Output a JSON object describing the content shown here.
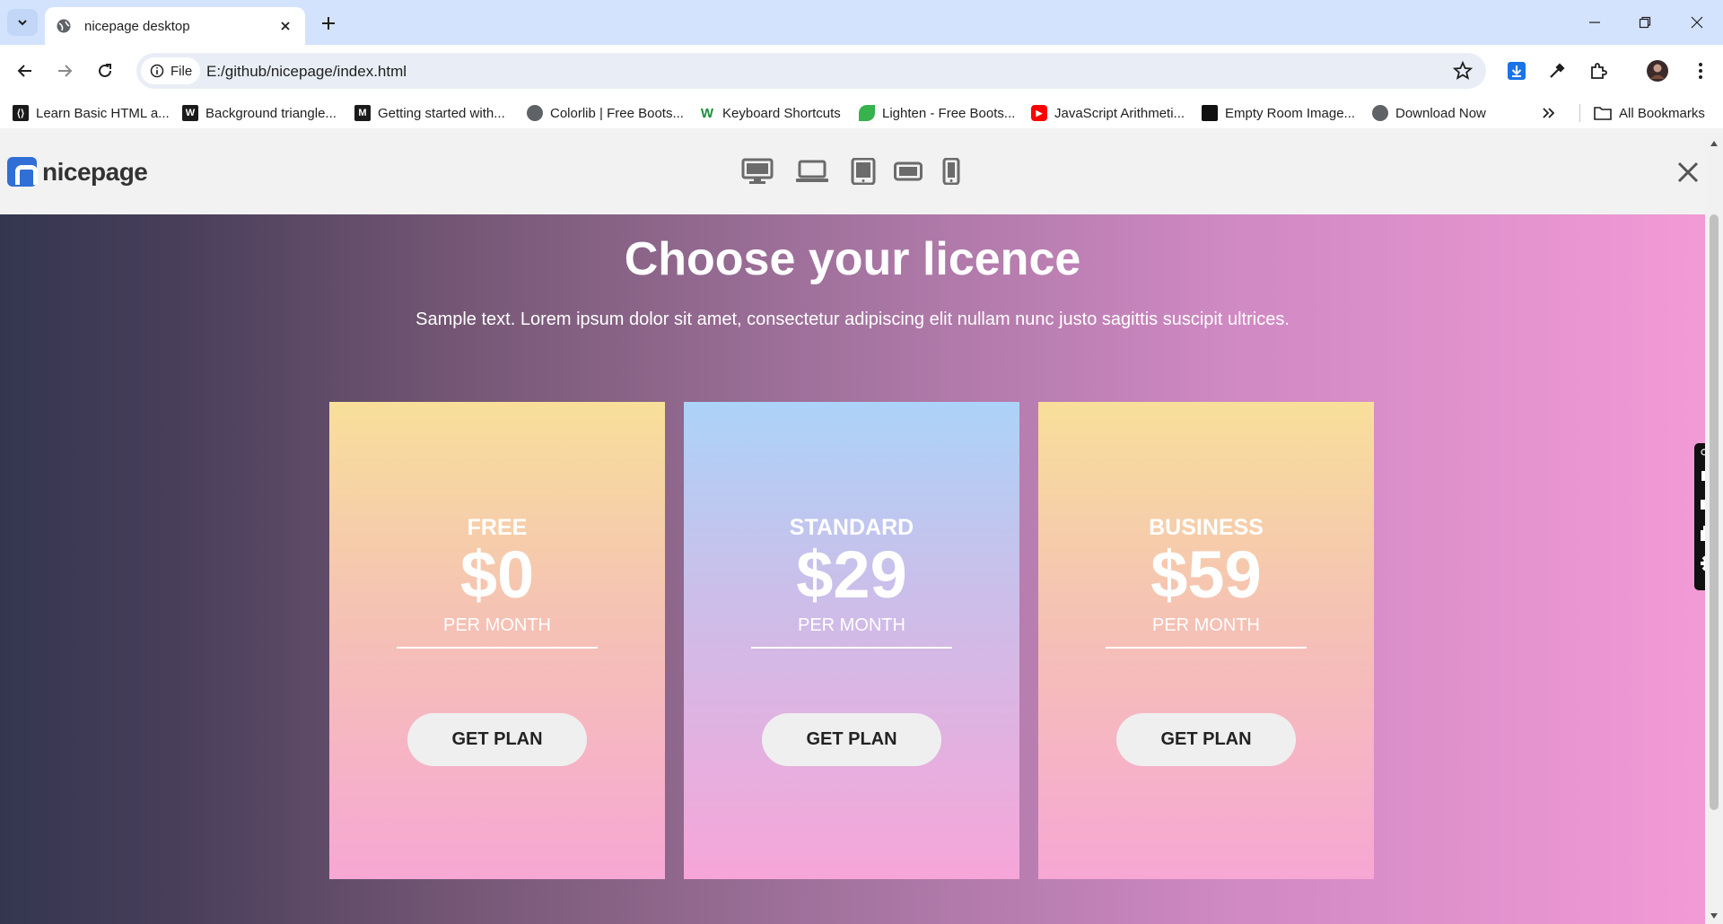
{
  "browser": {
    "tab_title": "nicepage desktop",
    "site_chip": "File",
    "url": "E:/github/nicepage/index.html",
    "bookmarks": [
      {
        "label": "Learn Basic HTML a...",
        "icon": "code-icon",
        "color": "#1a1a1a"
      },
      {
        "label": "Background triangle...",
        "icon": "w-icon",
        "color": "#1a1a1a"
      },
      {
        "label": "Getting started with...",
        "icon": "m-icon",
        "color": "#1a1a1a"
      },
      {
        "label": "Colorlib | Free Boots...",
        "icon": "globe-icon",
        "color": "#5f6368"
      },
      {
        "label": "Keyboard Shortcuts",
        "icon": "wp-icon",
        "color": "#1c8f3a"
      },
      {
        "label": "Lighten - Free Boots...",
        "icon": "leaf-icon",
        "color": "#37b24d"
      },
      {
        "label": "JavaScript Arithmeti...",
        "icon": "youtube-icon",
        "color": "#ff0000"
      },
      {
        "label": "Empty Room Image...",
        "icon": "square-icon",
        "color": "#111111"
      },
      {
        "label": "Download Now",
        "icon": "globe-icon",
        "color": "#5f6368"
      }
    ],
    "all_bookmarks": "All Bookmarks"
  },
  "nicepage": {
    "logo_text": "nicepage",
    "devices": [
      "desktop-icon",
      "laptop-icon",
      "tablet-icon",
      "tablet-landscape-icon",
      "phone-icon"
    ]
  },
  "page": {
    "title": "Choose your licence",
    "subtitle": "Sample text. Lorem ipsum dolor sit amet, consectetur adipiscing elit nullam nunc justo sagittis suscipit ultrices.",
    "plans": [
      {
        "name": "FREE",
        "price": "$0",
        "period": "PER MONTH",
        "button": "GET PLAN"
      },
      {
        "name": "STANDARD",
        "price": "$29",
        "period": "PER MONTH",
        "button": "GET PLAN"
      },
      {
        "name": "BUSINESS",
        "price": "$59",
        "period": "PER MONTH",
        "button": "GET PLAN"
      }
    ]
  },
  "colors": {
    "tabstrip": "#d3e3fd",
    "nicepage_blue": "#2f6fd6",
    "button_bg": "#efefef"
  }
}
